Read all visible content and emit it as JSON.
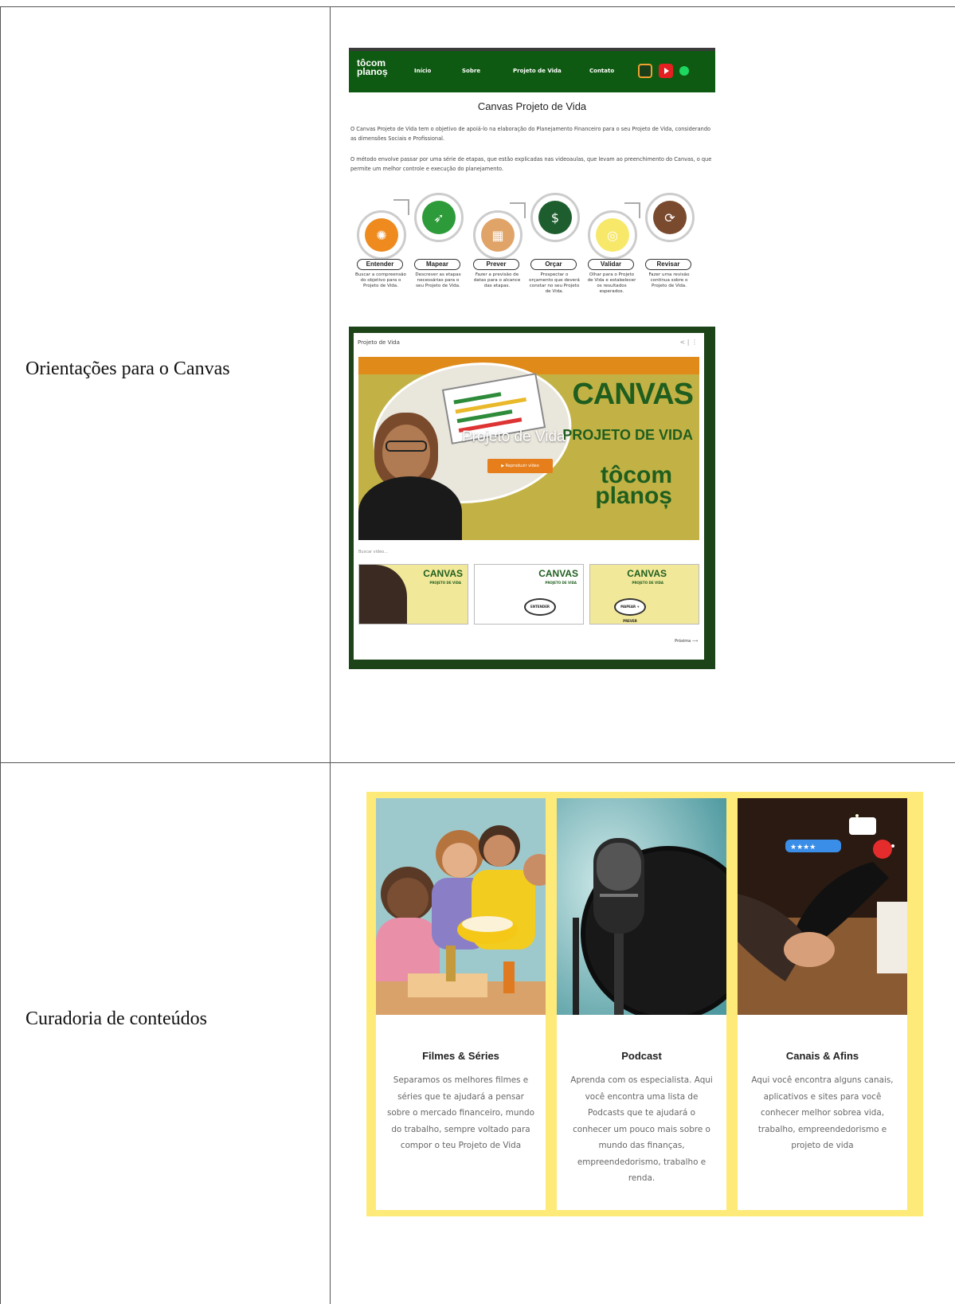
{
  "table": {
    "rows": [
      {
        "label": "Orientações para o Canvas"
      },
      {
        "label": "Curadoria de conteúdos"
      }
    ]
  },
  "canvas_site": {
    "logo": {
      "line1": "tôcom",
      "line2": "planoș"
    },
    "nav": [
      "Início",
      "Sobre",
      "Projeto de Vida",
      "Contato"
    ],
    "social_icons": [
      "instagram-icon",
      "youtube-icon",
      "spotify-icon"
    ],
    "title": "Canvas Projeto de Vida",
    "paragraphs": [
      "O Canvas Projeto de Vida tem o objetivo de apoiá-lo na elaboração do Planejamento Financeiro para o seu Projeto de Vida, considerando as dimensões Sociais e Profissional.",
      "O método envolve passar por uma série de etapas, que estão explicadas nas videoaulas, que levam ao preenchimento do Canvas, o que permite um melhor controle e execução do planejamento."
    ],
    "steps": [
      {
        "label": "Entender",
        "desc": "Buscar a compreensão do objetivo para o Projeto de Vida.",
        "color": "#ee8a1e",
        "icon": "lightbulb-icon"
      },
      {
        "label": "Mapear",
        "desc": "Descrever as etapas necessárias para o seu Projeto de Vida.",
        "color": "#2e9b3a",
        "icon": "rocket-icon"
      },
      {
        "label": "Prever",
        "desc": "Fazer a previsão de datas para o alcance das etapas.",
        "color": "#e0a468",
        "icon": "calendar-icon"
      },
      {
        "label": "Orçar",
        "desc": "Prospectar o orçamento que deverá constar no seu Projeto de Vida.",
        "color": "#1e5e2e",
        "icon": "dollar-icon"
      },
      {
        "label": "Validar",
        "desc": "Olhar para o Projeto de Vida e estabelecer os resultados esperados.",
        "color": "#f7e86a",
        "icon": "target-icon"
      },
      {
        "label": "Revisar",
        "desc": "Fazer uma revisão contínua sobre o Projeto de Vida.",
        "color": "#7a4a2e",
        "icon": "cycle-icon"
      }
    ],
    "video": {
      "playlist_title": "Projeto de Vida",
      "overlay_title": "Projeto de Vida",
      "hero_canvas": "CANVAS",
      "hero_subtitle": "PROJETO DE VIDA",
      "brand_line1": "tôcom",
      "brand_line2": "planoș",
      "play_label": "▶  Reproduzir vídeo",
      "search_placeholder": "Buscar vídeo...",
      "thumbs": [
        {
          "title": "CANVAS",
          "subtitle": "PROJETO DE VIDA",
          "badge": ""
        },
        {
          "title": "CANVAS",
          "subtitle": "PROJETO DE VIDA",
          "badge": "ENTENDER"
        },
        {
          "title": "CANVAS",
          "subtitle": "PROJETO DE VIDA",
          "badge": "MAPEAR + PREVER"
        }
      ],
      "next_label": "Próxima ⟶"
    }
  },
  "curadoria": {
    "cards": [
      {
        "title": "Filmes & Séries",
        "text": "Separamos os melhores filmes e séries que te ajudará a pensar sobre o mercado financeiro, mundo do trabalho, sempre voltado para compor o teu Projeto de Vida"
      },
      {
        "title": "Podcast",
        "text": "Aprenda com os especialista. Aqui você encontra uma lista de Podcasts que te ajudará o conhecer um pouco mais sobre o mundo das finanças, empreendedorismo, trabalho e renda."
      },
      {
        "title": "Canais & Afins",
        "text": "Aqui você encontra alguns canais, aplicativos e sites para você conhecer melhor sobrea  vida, trabalho, empreendedorismo e projeto de vida"
      }
    ]
  }
}
